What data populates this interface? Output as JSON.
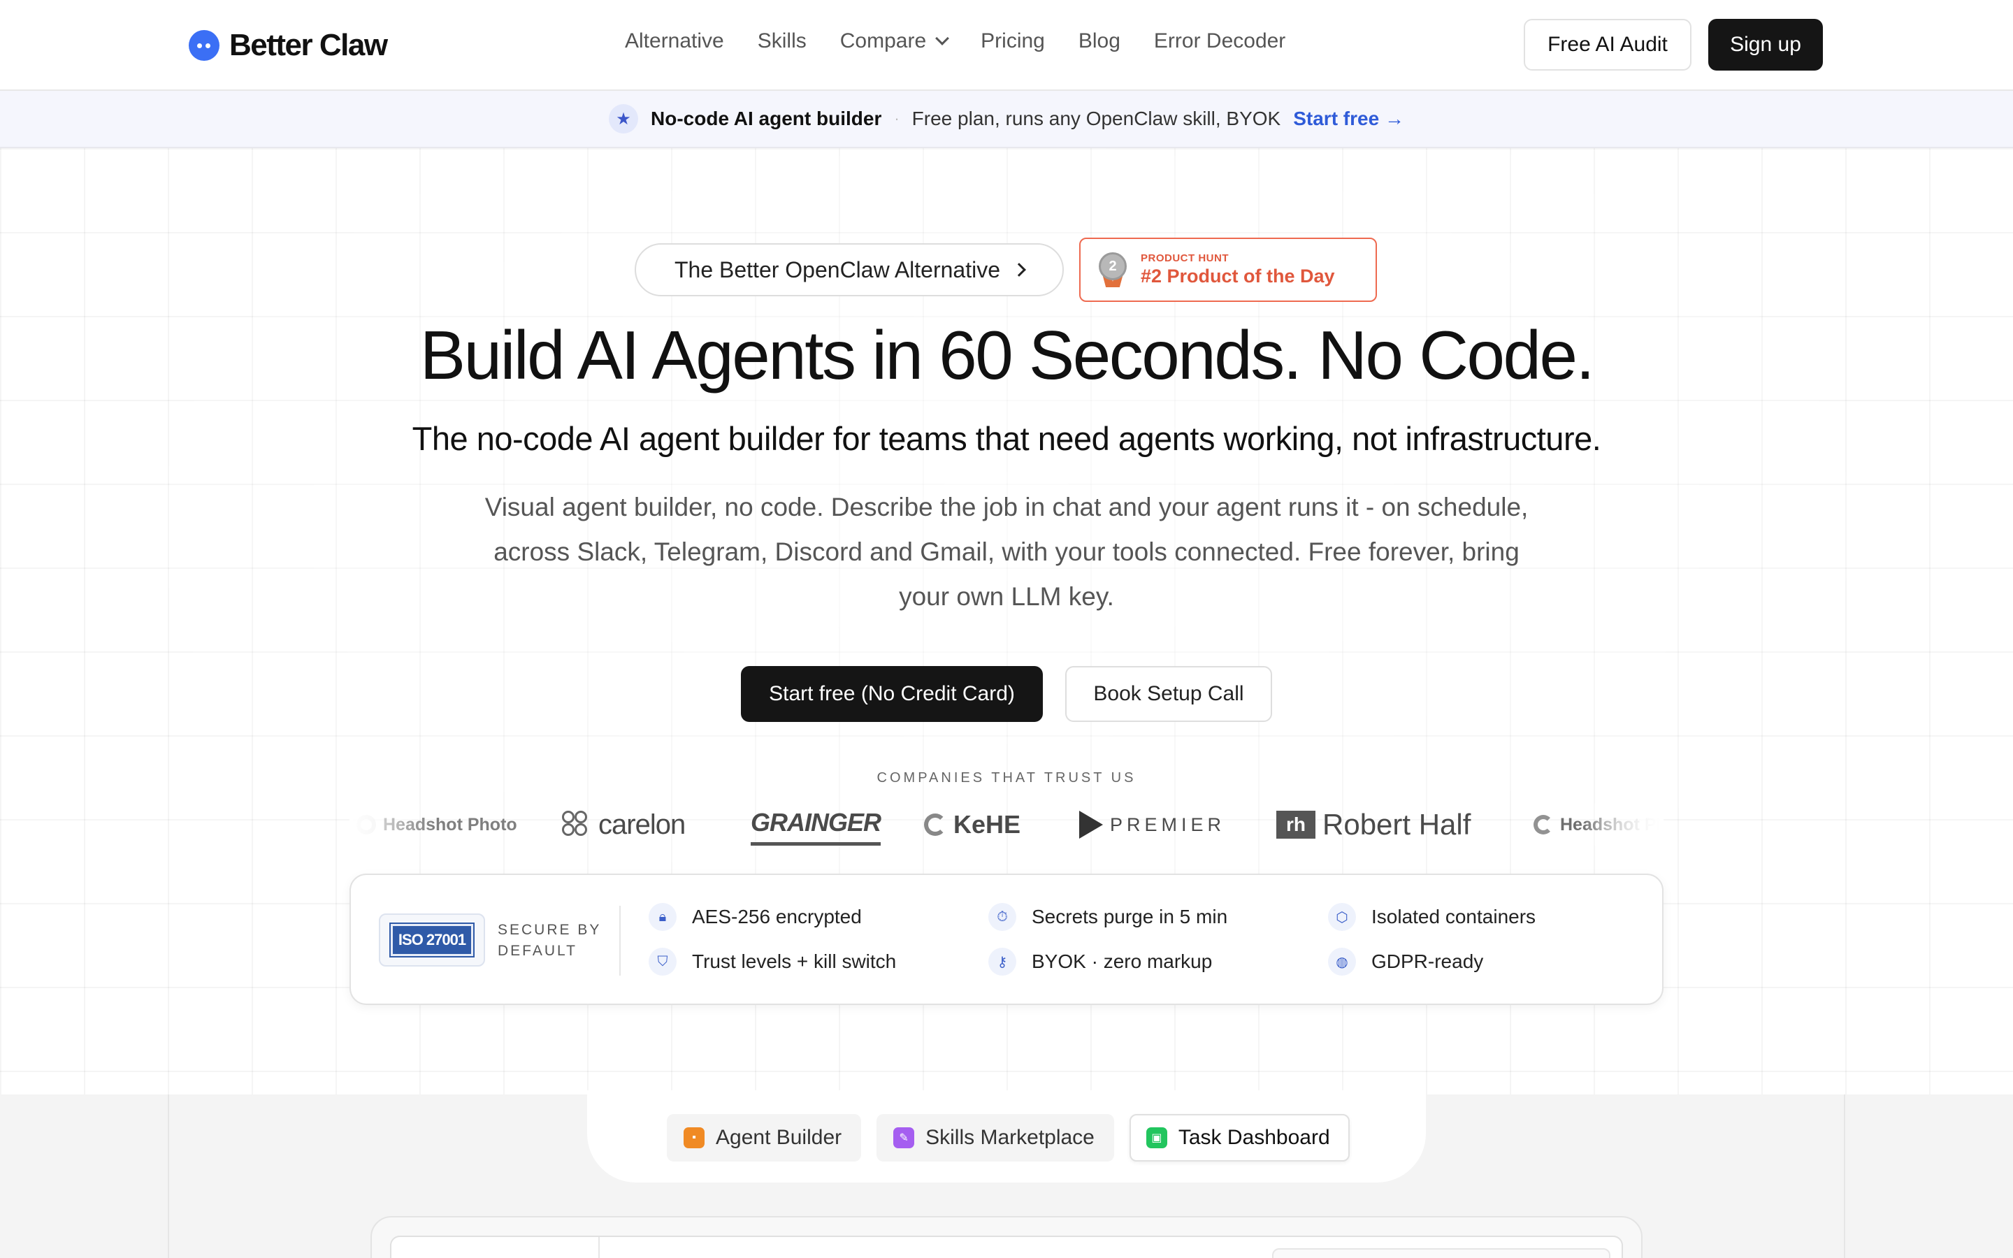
{
  "header": {
    "brand": "Better Claw",
    "nav": [
      {
        "label": "Alternative"
      },
      {
        "label": "Skills"
      },
      {
        "label": "Compare",
        "has_dropdown": true
      },
      {
        "label": "Pricing"
      },
      {
        "label": "Blog"
      },
      {
        "label": "Error Decoder"
      }
    ],
    "audit_label": "Free AI Audit",
    "signup_label": "Sign up"
  },
  "announcement": {
    "icon": "star-icon",
    "title": "No-code AI agent builder",
    "separator": "·",
    "text": "Free plan, runs any OpenClaw skill, BYOK",
    "link": "Start free →"
  },
  "hero": {
    "pill_label": "The Better OpenClaw Alternative",
    "product_hunt": {
      "small": "PRODUCT HUNT",
      "big": "#2 Product of the Day",
      "rank": "2"
    },
    "title": "Build AI Agents in 60 Seconds. No Code.",
    "subtitle": "The no-code AI agent builder for teams that need agents working, not infrastructure.",
    "description": "Visual agent builder, no code. Describe the job in chat and your agent runs it - on schedule, across Slack, Telegram, Discord and Gmail, with your tools connected. Free forever, bring your own LLM key.",
    "cta_primary": "Start free (No Credit Card)",
    "cta_secondary": "Book Setup Call"
  },
  "trust": {
    "label": "COMPANIES THAT TRUST US",
    "logos": [
      "Headshot Photo",
      "carelon",
      "GRAINGER",
      "KeHE",
      "PREMIER",
      "Robert Half",
      "Headshot Ph"
    ]
  },
  "security": {
    "badge": "ISO 27001",
    "label_line1": "SECURE BY",
    "label_line2": "DEFAULT",
    "features": [
      {
        "icon": "lock-icon",
        "label": "AES-256 encrypted"
      },
      {
        "icon": "timer-icon",
        "label": "Secrets purge in 5 min"
      },
      {
        "icon": "container-icon",
        "label": "Isolated containers"
      },
      {
        "icon": "shield-icon",
        "label": "Trust levels + kill switch"
      },
      {
        "icon": "key-icon",
        "label": "BYOK · zero markup"
      },
      {
        "icon": "globe-icon",
        "label": "GDPR-ready"
      }
    ]
  },
  "tabs": [
    {
      "label": "Agent Builder",
      "color": "#f08a24",
      "active": false
    },
    {
      "label": "Skills Marketplace",
      "color": "#a55ef0",
      "active": false
    },
    {
      "label": "Task Dashboard",
      "color": "#22c55e",
      "active": true
    }
  ]
}
